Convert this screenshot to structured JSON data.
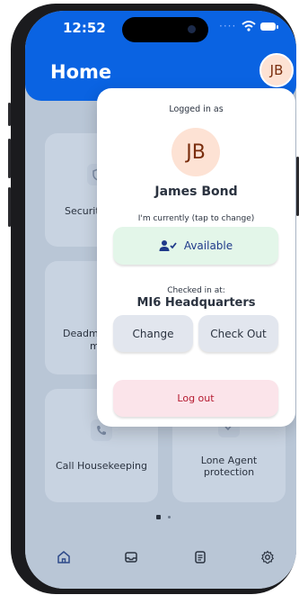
{
  "status_bar": {
    "time": "12:52"
  },
  "header": {
    "title": "Home"
  },
  "user": {
    "initials": "JB",
    "name": "James Bond"
  },
  "popover": {
    "logged_in_as": "Logged in as",
    "status_prompt": "I'm currently (tap to change)",
    "availability": "Available",
    "checked_in_label": "Checked in at:",
    "location": "MI6 Headquarters",
    "change_label": "Change",
    "checkout_label": "Check Out",
    "logout_label": "Log out"
  },
  "cards": [
    {
      "label": "Securit",
      "icon": "shield-icon"
    },
    {
      "label": "Deadma",
      "label2": "m",
      "icon": "timer-icon"
    },
    {
      "label": "Call Housekeeping",
      "icon": "phone-icon"
    },
    {
      "label": "Lone Agent",
      "label2": "protection",
      "icon": "check-icon"
    }
  ],
  "tabs": [
    {
      "icon": "home-icon"
    },
    {
      "icon": "inbox-icon"
    },
    {
      "icon": "clipboard-icon"
    },
    {
      "icon": "settings-icon"
    }
  ],
  "colors": {
    "brand_blue": "#0a63e2",
    "available_green": "#e3f6e9",
    "logout_pink": "#fbe4ea",
    "logout_text": "#b5192f"
  }
}
